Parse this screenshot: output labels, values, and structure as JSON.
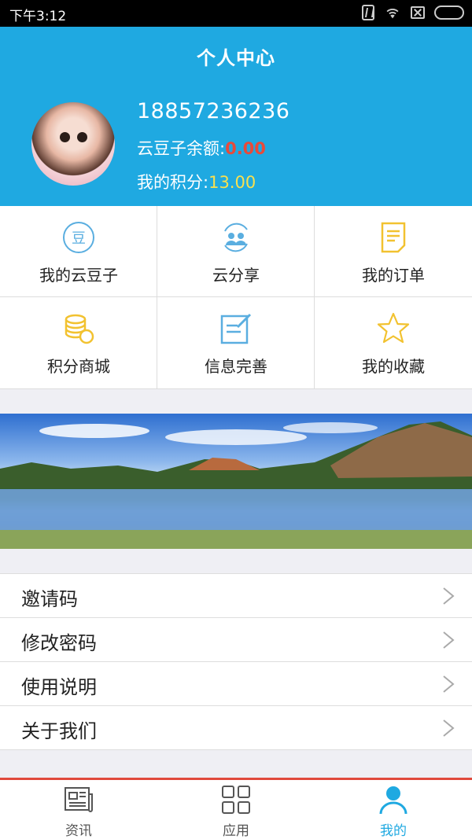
{
  "status_bar": {
    "time": "下午3:12",
    "icons": [
      "nfc-icon",
      "wifi-icon",
      "sim-off-icon",
      "battery-icon"
    ]
  },
  "header": {
    "title": "个人中心",
    "phone": "18857236236",
    "balance_label": "云豆子余额:",
    "balance_value": "0.00",
    "points_label": "我的积分:",
    "points_value": "13.00",
    "colors": {
      "background": "#1fa9e1",
      "balance": "#e84a3a",
      "points": "#f8e04f"
    }
  },
  "grid": {
    "items": [
      {
        "label": "我的云豆子",
        "icon": "bean-coin-icon"
      },
      {
        "label": "云分享",
        "icon": "share-users-icon"
      },
      {
        "label": "我的订单",
        "icon": "order-document-icon"
      },
      {
        "label": "积分商城",
        "icon": "coin-stack-icon"
      },
      {
        "label": "信息完善",
        "icon": "edit-form-icon"
      },
      {
        "label": "我的收藏",
        "icon": "star-icon"
      }
    ]
  },
  "menu": {
    "items": [
      {
        "label": "邀请码"
      },
      {
        "label": "修改密码"
      },
      {
        "label": "使用说明"
      },
      {
        "label": "关于我们"
      }
    ]
  },
  "tabbar": {
    "items": [
      {
        "label": "资讯",
        "icon": "news-icon"
      },
      {
        "label": "应用",
        "icon": "apps-grid-icon"
      },
      {
        "label": "我的",
        "icon": "user-icon"
      }
    ],
    "active_color": "#1fa9e1",
    "accent_line": "#e0493c"
  }
}
